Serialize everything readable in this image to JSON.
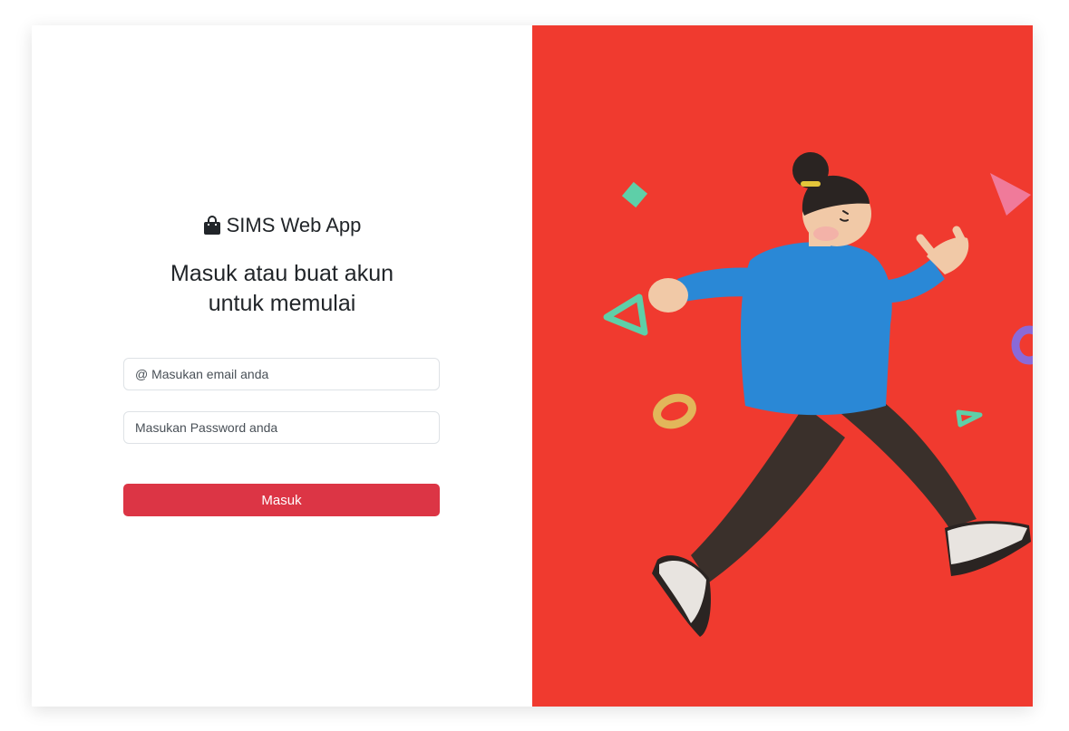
{
  "brand": {
    "icon": "shopping-bag-icon",
    "title": "SIMS Web App"
  },
  "heading": {
    "line1": "Masuk atau buat akun",
    "line2": "untuk memulai"
  },
  "form": {
    "email_placeholder": "@ Masukan email anda",
    "password_placeholder": "Masukan Password anda",
    "submit_label": "Masuk"
  },
  "colors": {
    "primary_button": "#dc3545",
    "hero_background": "#f03a2f",
    "text": "#212529"
  },
  "hero": {
    "illustration": "walking-person-illustration"
  }
}
